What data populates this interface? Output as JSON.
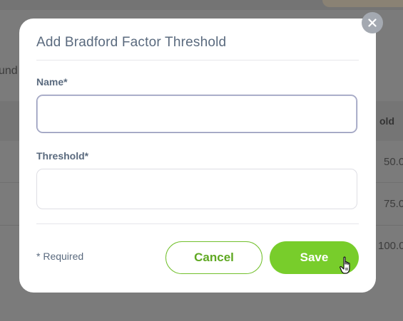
{
  "background": {
    "left_fragment": "und",
    "header_fragment": "old",
    "rows": [
      "50.0",
      "75.0",
      "100.0"
    ]
  },
  "modal": {
    "title": "Add Bradford Factor Threshold",
    "name_label": "Name*",
    "name_value": "",
    "threshold_label": "Threshold*",
    "threshold_value": "",
    "required_note": "* Required",
    "cancel_label": "Cancel",
    "save_label": "Save"
  },
  "colors": {
    "accent": "#78cd2b",
    "title": "#5a6a7e",
    "close": "#a4a9b1"
  },
  "icons": {
    "close": "close-icon",
    "cursor": "hand-pointer-icon"
  }
}
